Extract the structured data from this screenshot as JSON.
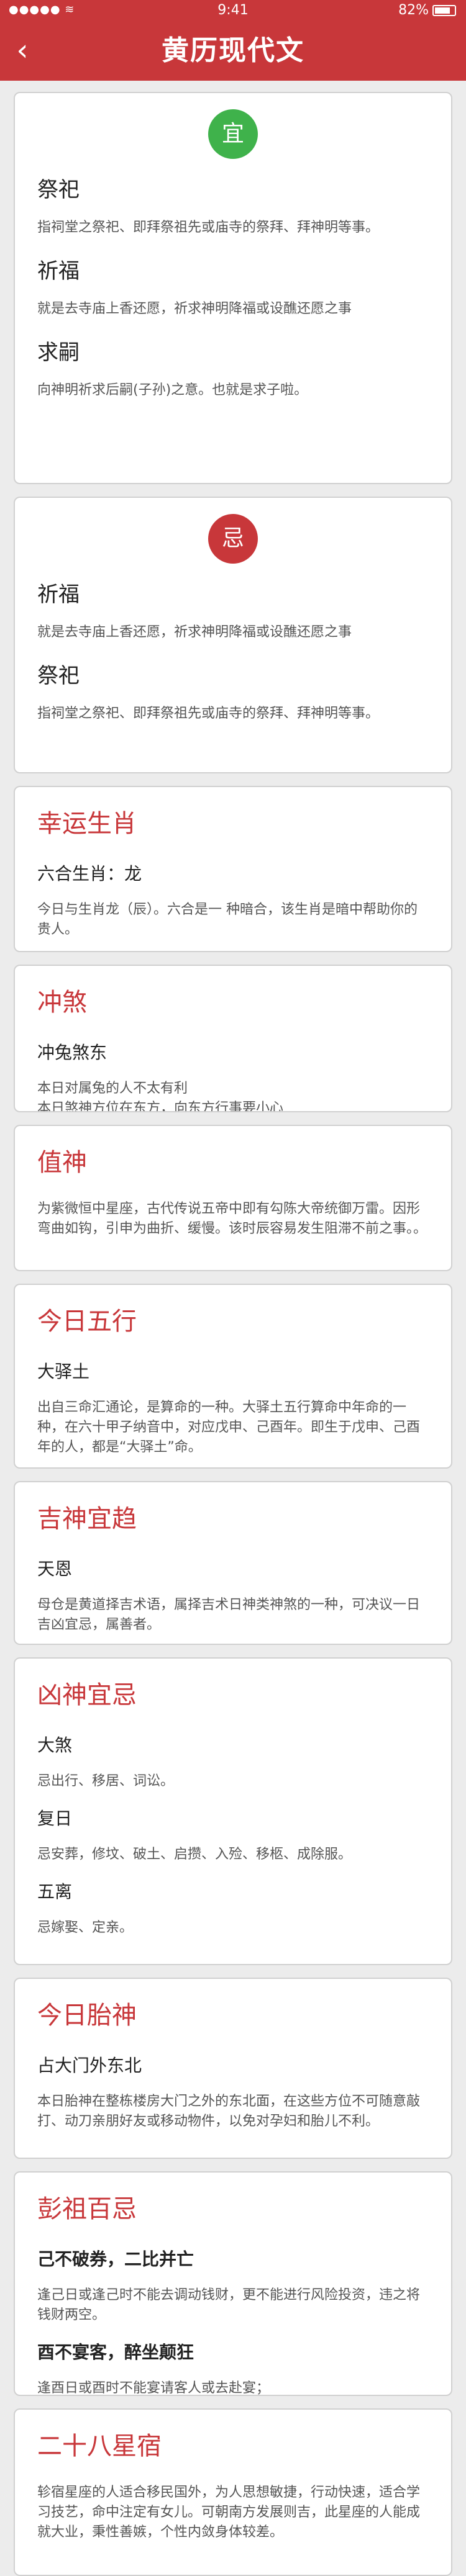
{
  "status": {
    "signal": "●●●●● ≋",
    "time": "9:41",
    "battery": "82%"
  },
  "nav": {
    "title": "黄历现代文"
  },
  "yi": {
    "badge": "宜",
    "items": [
      {
        "title": "祭祀",
        "desc": "指祠堂之祭祀、即拜祭祖先或庙寺的祭拜、拜神明等事。"
      },
      {
        "title": "祈福",
        "desc": "就是去寺庙上香还愿，祈求神明降福或设醮还愿之事"
      },
      {
        "title": "求嗣",
        "desc": "向神明祈求后嗣(子孙)之意。也就是求子啦。"
      }
    ]
  },
  "ji": {
    "badge": "忌",
    "items": [
      {
        "title": "祈福",
        "desc": "就是去寺庙上香还愿，祈求神明降福或设醮还愿之事"
      },
      {
        "title": "祭祀",
        "desc": "指祠堂之祭祀、即拜祭祖先或庙寺的祭拜、拜神明等事。"
      }
    ]
  },
  "lucky_zodiac": {
    "title": "幸运生肖",
    "sub": "六合生肖：龙",
    "desc": "今日与生肖龙（辰）。六合是一 种暗合，该生肖是暗中帮助你的贵人。"
  },
  "clash": {
    "title": "冲煞",
    "sub": "冲兔煞东",
    "desc": "本日对属兔的人不太有利\n本日煞神方位在东方，向东方行事要小心"
  },
  "duty_god": {
    "title": "值神",
    "desc": "为紫微恒中星座，古代传说五帝中即有勾陈大帝统御万雷。因形弯曲如钩，引申为曲折、缓慢。该时辰容易发生阻滞不前之事。。"
  },
  "five_elements": {
    "title": "今日五行",
    "sub": "大驿土",
    "desc": "出自三命汇通论，是算命的一种。大驿土五行算命中年命的一种，在六十甲子纳音中，对应戊申、己酉年。即生于戊申、己酉年的人，都是“大驿土”命。"
  },
  "good_gods": {
    "title": "吉神宜趋",
    "sub": "天恩",
    "desc": "母仓是黄道择吉术语，属择吉术日神类神煞的一种，可决议一日吉凶宜忌，属善者。"
  },
  "evil_gods": {
    "title": "凶神宜忌",
    "items": [
      {
        "name": "大煞",
        "desc": "忌出行、移居、词讼。"
      },
      {
        "name": "复日",
        "desc": "忌安葬，修坟、破土、启攒、入殓、移柩、成除服。"
      },
      {
        "name": "五离",
        "desc": "忌嫁娶、定亲。"
      }
    ]
  },
  "fetal_god": {
    "title": "今日胎神",
    "sub": "占大门外东北",
    "desc": "本日胎神在整栋楼房大门之外的东北面，在这些方位不可随意敲打、动刀亲朋好友或移动物件，以免对孕妇和胎儿不利。"
  },
  "pengzu": {
    "title": "彭祖百忌",
    "items": [
      {
        "name": "己不破券，二比并亡",
        "desc": "逢己日或逢己时不能去调动钱财，更不能进行风险投资，违之将钱财两空。"
      },
      {
        "name": "酉不宴客，醉坐颠狂",
        "desc": "逢酉日或酉时不能宴请客人或去赴宴；"
      }
    ]
  },
  "mansion": {
    "title": "二十八星宿",
    "desc": "轸宿星座的人适合移民国外，为人思想敏捷，行动快速，适合学习技艺，命中注定有女儿。可朝南方发展则吉，此星座的人能成就大业，秉性善嫉，个性内敛身体较差。"
  }
}
